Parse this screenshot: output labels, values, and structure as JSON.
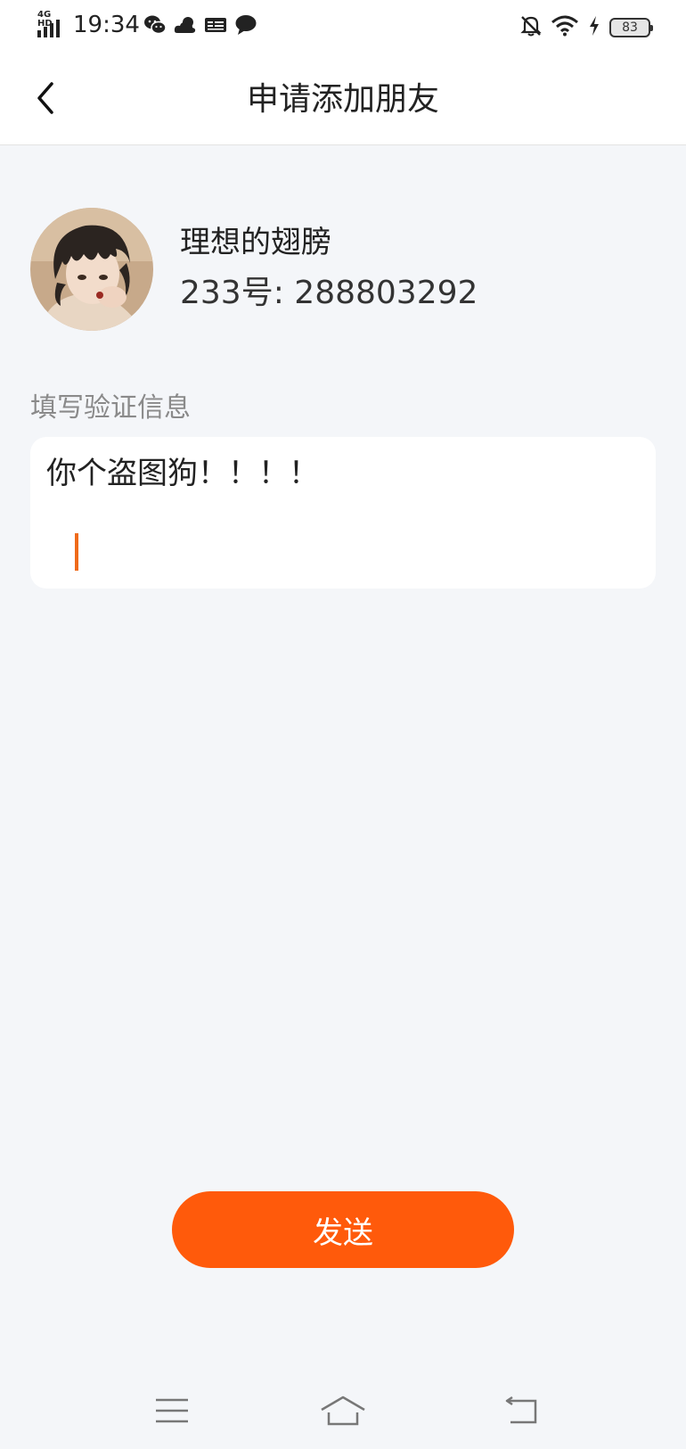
{
  "status_bar": {
    "time": "19:34",
    "network": "4G HD",
    "battery": "83",
    "icons": [
      "wechat-icon",
      "weather-cloud-icon",
      "toutiao-icon",
      "message-bubble-icon"
    ],
    "right_icons": [
      "mute-bell-icon",
      "wifi-icon",
      "charging-icon",
      "battery-icon"
    ]
  },
  "header": {
    "title": "申请添加朋友",
    "back_icon": "chevron-left-icon"
  },
  "profile": {
    "name": "理想的翅膀",
    "id_text": "233号: 288803292"
  },
  "verify": {
    "label": "填写验证信息",
    "message": "你个盗图狗！！！！"
  },
  "send_button": {
    "label": "发送",
    "color": "#ff5a0b"
  },
  "nav_bar": {
    "icons": [
      "menu-icon",
      "home-icon",
      "back-icon"
    ]
  },
  "colors": {
    "accent": "#ff5a0b",
    "caret": "#ef6a1a",
    "background": "#f4f6f9"
  }
}
